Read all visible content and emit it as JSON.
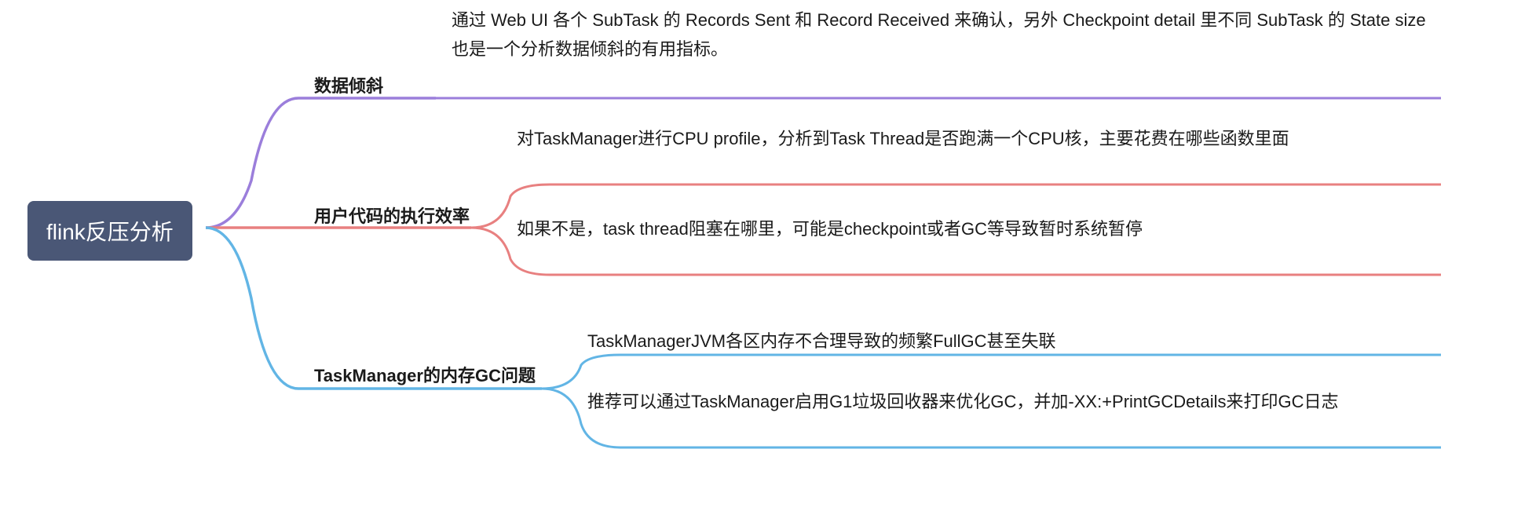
{
  "root": {
    "title": "flink反压分析"
  },
  "colors": {
    "purple": "#9b7edb",
    "red": "#e88080",
    "blue": "#62b5e5",
    "root_bg": "#4a5776"
  },
  "branches": [
    {
      "id": "b1",
      "label": "数据倾斜",
      "leaves": [
        {
          "id": "b1l1",
          "text": "通过 Web UI 各个 SubTask 的 Records Sent 和 Record Received 来确认，另外 Checkpoint detail 里不同 SubTask 的 State size 也是一个分析数据倾斜的有用指标。"
        }
      ]
    },
    {
      "id": "b2",
      "label": "用户代码的执行效率",
      "leaves": [
        {
          "id": "b2l1",
          "text": "对TaskManager进行CPU profile，分析到Task Thread是否跑满一个CPU核，主要花费在哪些函数里面"
        },
        {
          "id": "b2l2",
          "text": "如果不是，task thread阻塞在哪里，可能是checkpoint或者GC等导致暂时系统暂停"
        }
      ]
    },
    {
      "id": "b3",
      "label": "TaskManager的内存GC问题",
      "leaves": [
        {
          "id": "b3l1",
          "text": "TaskManagerJVM各区内存不合理导致的频繁FullGC甚至失联"
        },
        {
          "id": "b3l2",
          "text": "推荐可以通过TaskManager启用G1垃圾回收器来优化GC，并加-XX:+PrintGCDetails来打印GC日志"
        }
      ]
    }
  ]
}
